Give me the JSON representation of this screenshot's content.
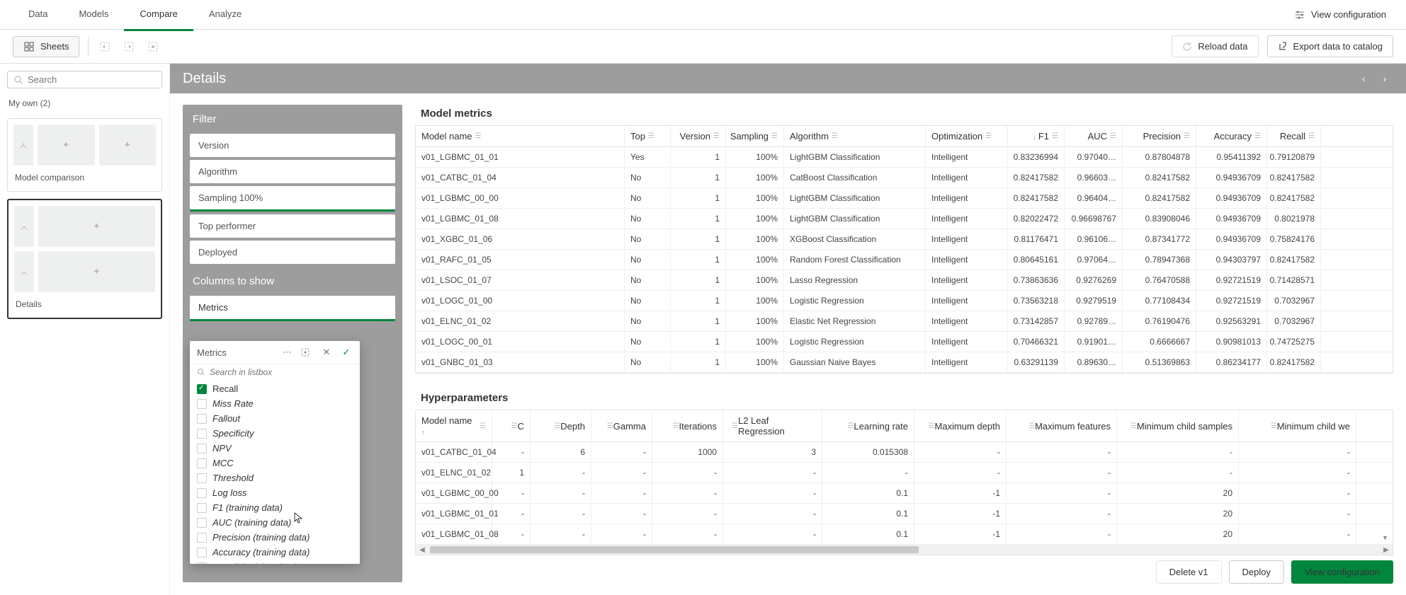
{
  "top_tabs": [
    "Data",
    "Models",
    "Compare",
    "Analyze"
  ],
  "top_tab_active": 2,
  "view_config_label": "View configuration",
  "sheets_label": "Sheets",
  "reload_label": "Reload data",
  "export_label": "Export data to catalog",
  "search_placeholder": "Search",
  "my_own_label": "My own (2)",
  "thumb_labels": [
    "Model comparison",
    "Details"
  ],
  "details_title": "Details",
  "filter_heading": "Filter",
  "filter_items": [
    "Version",
    "Algorithm",
    "Sampling 100%",
    "Top performer",
    "Deployed"
  ],
  "filter_active_index": 2,
  "columns_heading": "Columns to show",
  "metrics_label": "Metrics",
  "metrics_pop_title": "Metrics",
  "metrics_search_placeholder": "Search in listbox",
  "metrics_options": [
    {
      "label": "Recall",
      "checked": true
    },
    {
      "label": "Miss Rate",
      "checked": false
    },
    {
      "label": "Fallout",
      "checked": false
    },
    {
      "label": "Specificity",
      "checked": false
    },
    {
      "label": "NPV",
      "checked": false
    },
    {
      "label": "MCC",
      "checked": false
    },
    {
      "label": "Threshold",
      "checked": false
    },
    {
      "label": "Log loss",
      "checked": false
    },
    {
      "label": "F1 (training data)",
      "checked": false
    },
    {
      "label": "AUC (training data)",
      "checked": false
    },
    {
      "label": "Precision (training data)",
      "checked": false
    },
    {
      "label": "Accuracy (training data)",
      "checked": false
    },
    {
      "label": "Recall (training data)",
      "checked": false
    }
  ],
  "model_metrics_title": "Model metrics",
  "mm_headers": [
    "Model name",
    "Top",
    "Version",
    "Sampling",
    "Algorithm",
    "Optimization",
    "F1",
    "AUC",
    "Precision",
    "Accuracy",
    "Recall"
  ],
  "mm_sorted_col": 6,
  "mm_rows": [
    {
      "name": "v01_LGBMC_01_01",
      "top": "Yes",
      "ver": "1",
      "samp": "100%",
      "alg": "LightGBM Classification",
      "opt": "Intelligent",
      "f1": "0.83236994",
      "auc": "0.97040…",
      "prec": "0.87804878",
      "acc": "0.95411392",
      "rec": "0.79120879"
    },
    {
      "name": "v01_CATBC_01_04",
      "top": "No",
      "ver": "1",
      "samp": "100%",
      "alg": "CatBoost Classification",
      "opt": "Intelligent",
      "f1": "0.82417582",
      "auc": "0.96603…",
      "prec": "0.82417582",
      "acc": "0.94936709",
      "rec": "0.82417582"
    },
    {
      "name": "v01_LGBMC_00_00",
      "top": "No",
      "ver": "1",
      "samp": "100%",
      "alg": "LightGBM Classification",
      "opt": "Intelligent",
      "f1": "0.82417582",
      "auc": "0.96404…",
      "prec": "0.82417582",
      "acc": "0.94936709",
      "rec": "0.82417582"
    },
    {
      "name": "v01_LGBMC_01_08",
      "top": "No",
      "ver": "1",
      "samp": "100%",
      "alg": "LightGBM Classification",
      "opt": "Intelligent",
      "f1": "0.82022472",
      "auc": "0.96698767",
      "prec": "0.83908046",
      "acc": "0.94936709",
      "rec": "0.8021978"
    },
    {
      "name": "v01_XGBC_01_06",
      "top": "No",
      "ver": "1",
      "samp": "100%",
      "alg": "XGBoost Classification",
      "opt": "Intelligent",
      "f1": "0.81176471",
      "auc": "0.96106…",
      "prec": "0.87341772",
      "acc": "0.94936709",
      "rec": "0.75824176"
    },
    {
      "name": "v01_RAFC_01_05",
      "top": "No",
      "ver": "1",
      "samp": "100%",
      "alg": "Random Forest Classification",
      "opt": "Intelligent",
      "f1": "0.80645161",
      "auc": "0.97064…",
      "prec": "0.78947368",
      "acc": "0.94303797",
      "rec": "0.82417582"
    },
    {
      "name": "v01_LSOC_01_07",
      "top": "No",
      "ver": "1",
      "samp": "100%",
      "alg": "Lasso Regression",
      "opt": "Intelligent",
      "f1": "0.73863636",
      "auc": "0.9276269",
      "prec": "0.76470588",
      "acc": "0.92721519",
      "rec": "0.71428571"
    },
    {
      "name": "v01_LOGC_01_00",
      "top": "No",
      "ver": "1",
      "samp": "100%",
      "alg": "Logistic Regression",
      "opt": "Intelligent",
      "f1": "0.73563218",
      "auc": "0.9279519",
      "prec": "0.77108434",
      "acc": "0.92721519",
      "rec": "0.7032967"
    },
    {
      "name": "v01_ELNC_01_02",
      "top": "No",
      "ver": "1",
      "samp": "100%",
      "alg": "Elastic Net Regression",
      "opt": "Intelligent",
      "f1": "0.73142857",
      "auc": "0.92789…",
      "prec": "0.76190476",
      "acc": "0.92563291",
      "rec": "0.7032967"
    },
    {
      "name": "v01_LOGC_00_01",
      "top": "No",
      "ver": "1",
      "samp": "100%",
      "alg": "Logistic Regression",
      "opt": "Intelligent",
      "f1": "0.70466321",
      "auc": "0.91901…",
      "prec": "0.6666667",
      "acc": "0.90981013",
      "rec": "0.74725275"
    },
    {
      "name": "v01_GNBC_01_03",
      "top": "No",
      "ver": "1",
      "samp": "100%",
      "alg": "Gaussian Naive Bayes",
      "opt": "Intelligent",
      "f1": "0.63291139",
      "auc": "0.89630…",
      "prec": "0.51369863",
      "acc": "0.86234177",
      "rec": "0.82417582"
    }
  ],
  "hyper_title": "Hyperparameters",
  "hp_headers": [
    "Model name",
    "C",
    "Depth",
    "Gamma",
    "Iterations",
    "L2 Leaf Regression",
    "Learning rate",
    "Maximum depth",
    "Maximum features",
    "Minimum child samples",
    "Minimum child we"
  ],
  "hp_sorted_col": 0,
  "hp_rows": [
    {
      "name": "v01_CATBC_01_04",
      "c": "-",
      "depth": "6",
      "gamma": "-",
      "iter": "1000",
      "l2": "3",
      "lr": "0.015308",
      "maxd": "-",
      "maxf": "-",
      "mcs": "-",
      "mcw": "-"
    },
    {
      "name": "v01_ELNC_01_02",
      "c": "1",
      "depth": "-",
      "gamma": "-",
      "iter": "-",
      "l2": "-",
      "lr": "-",
      "maxd": "-",
      "maxf": "-",
      "mcs": "-",
      "mcw": "-"
    },
    {
      "name": "v01_LGBMC_00_00",
      "c": "-",
      "depth": "-",
      "gamma": "-",
      "iter": "-",
      "l2": "-",
      "lr": "0.1",
      "maxd": "-1",
      "maxf": "-",
      "mcs": "20",
      "mcw": "-"
    },
    {
      "name": "v01_LGBMC_01_01",
      "c": "-",
      "depth": "-",
      "gamma": "-",
      "iter": "-",
      "l2": "-",
      "lr": "0.1",
      "maxd": "-1",
      "maxf": "-",
      "mcs": "20",
      "mcw": "-"
    },
    {
      "name": "v01_LGBMC_01_08",
      "c": "-",
      "depth": "-",
      "gamma": "-",
      "iter": "-",
      "l2": "-",
      "lr": "0.1",
      "maxd": "-1",
      "maxf": "-",
      "mcs": "20",
      "mcw": "-"
    }
  ],
  "footer_buttons": {
    "delete": "Delete v1",
    "deploy": "Deploy",
    "view": "View configuration"
  }
}
